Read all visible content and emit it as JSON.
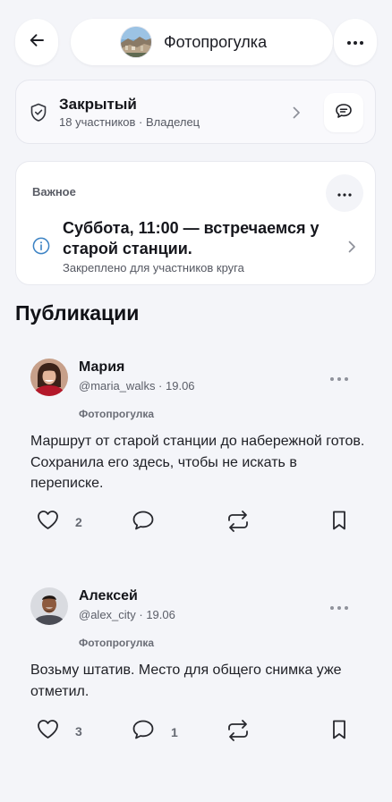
{
  "header": {
    "title": "Фотопрогулка",
    "back_icon": "back-arrow-icon",
    "menu_icon": "more-horizontal-icon"
  },
  "privacy": {
    "title": "Закрытый",
    "subtitle": "18 участников · Владелец"
  },
  "pinned": {
    "label": "Важное",
    "title": "Суббота, 11:00 — встречаемся у старой станции.",
    "subtitle": "Закреплено для участников круга"
  },
  "section_title": "Публикации",
  "posts": [
    {
      "author": "Мария",
      "handle_date": "@maria_walks · 19.06",
      "group": "Фотопрогулка",
      "text": "Маршрут от старой станции до набережной готов. Сохранила его здесь, чтобы не искать в переписке.",
      "likes": "2",
      "comments": ""
    },
    {
      "author": "Алексей",
      "handle_date": "@alex_city · 19.06",
      "group": "Фотопрогулка",
      "text": "Возьму штатив. Место для общего снимка уже отметил.",
      "likes": "3",
      "comments": "1"
    }
  ],
  "colors": {
    "background": "#f4f5f9",
    "card": "#ffffff",
    "text": "#14151a",
    "muted": "#5b5e68",
    "info_accent": "#3b82c4"
  }
}
